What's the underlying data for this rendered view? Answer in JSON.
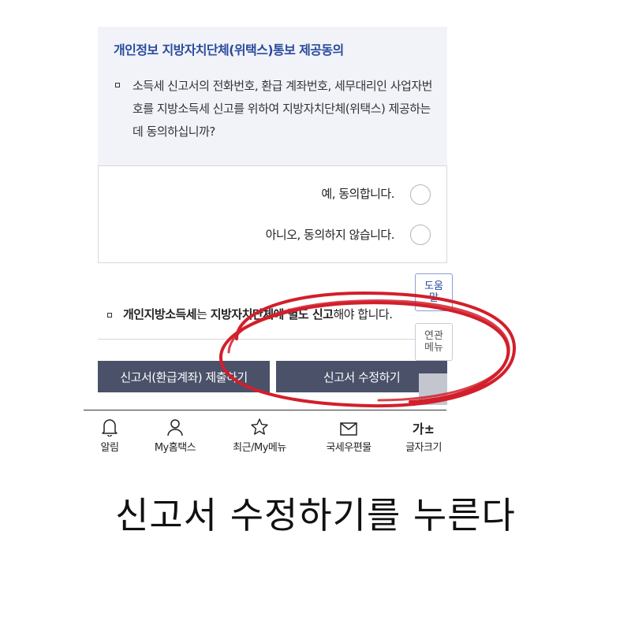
{
  "consent": {
    "title": "개인정보 지방자치단체(위택스)통보 제공동의",
    "body": "소득세 신고서의 전화번호, 환급 계좌번호, 세무대리인 사업자번호를 지방소득세 신고를 위하여 지방자치단체(위택스) 제공하는데 동의하십니까?"
  },
  "options": {
    "yes_label": "예, 동의합니다.",
    "no_label": "아니오, 동의하지 않습니다."
  },
  "notice": {
    "part1": "개인지방소득세",
    "part2": "는 ",
    "part3": "지방자치단체에 별도 신고",
    "part4": "해야 합니다."
  },
  "buttons": {
    "submit": "신고서(환급계좌) 제출하기",
    "edit": "신고서 수정하기"
  },
  "side": {
    "help_line1": "도움",
    "help_line2": "말",
    "related_line1": "연관",
    "related_line2": "메뉴"
  },
  "tabbar": {
    "alarm": "알림",
    "my": "My홈택스",
    "recent": "최근/My메뉴",
    "mail": "국세우편물",
    "font": "글자크기",
    "font_icon": "가±"
  },
  "caption": "신고서 수정하기를 누른다",
  "colors": {
    "title_blue": "#2a4b9b",
    "button_bg": "#4a5169",
    "annotation_red": "#d21f2b"
  }
}
